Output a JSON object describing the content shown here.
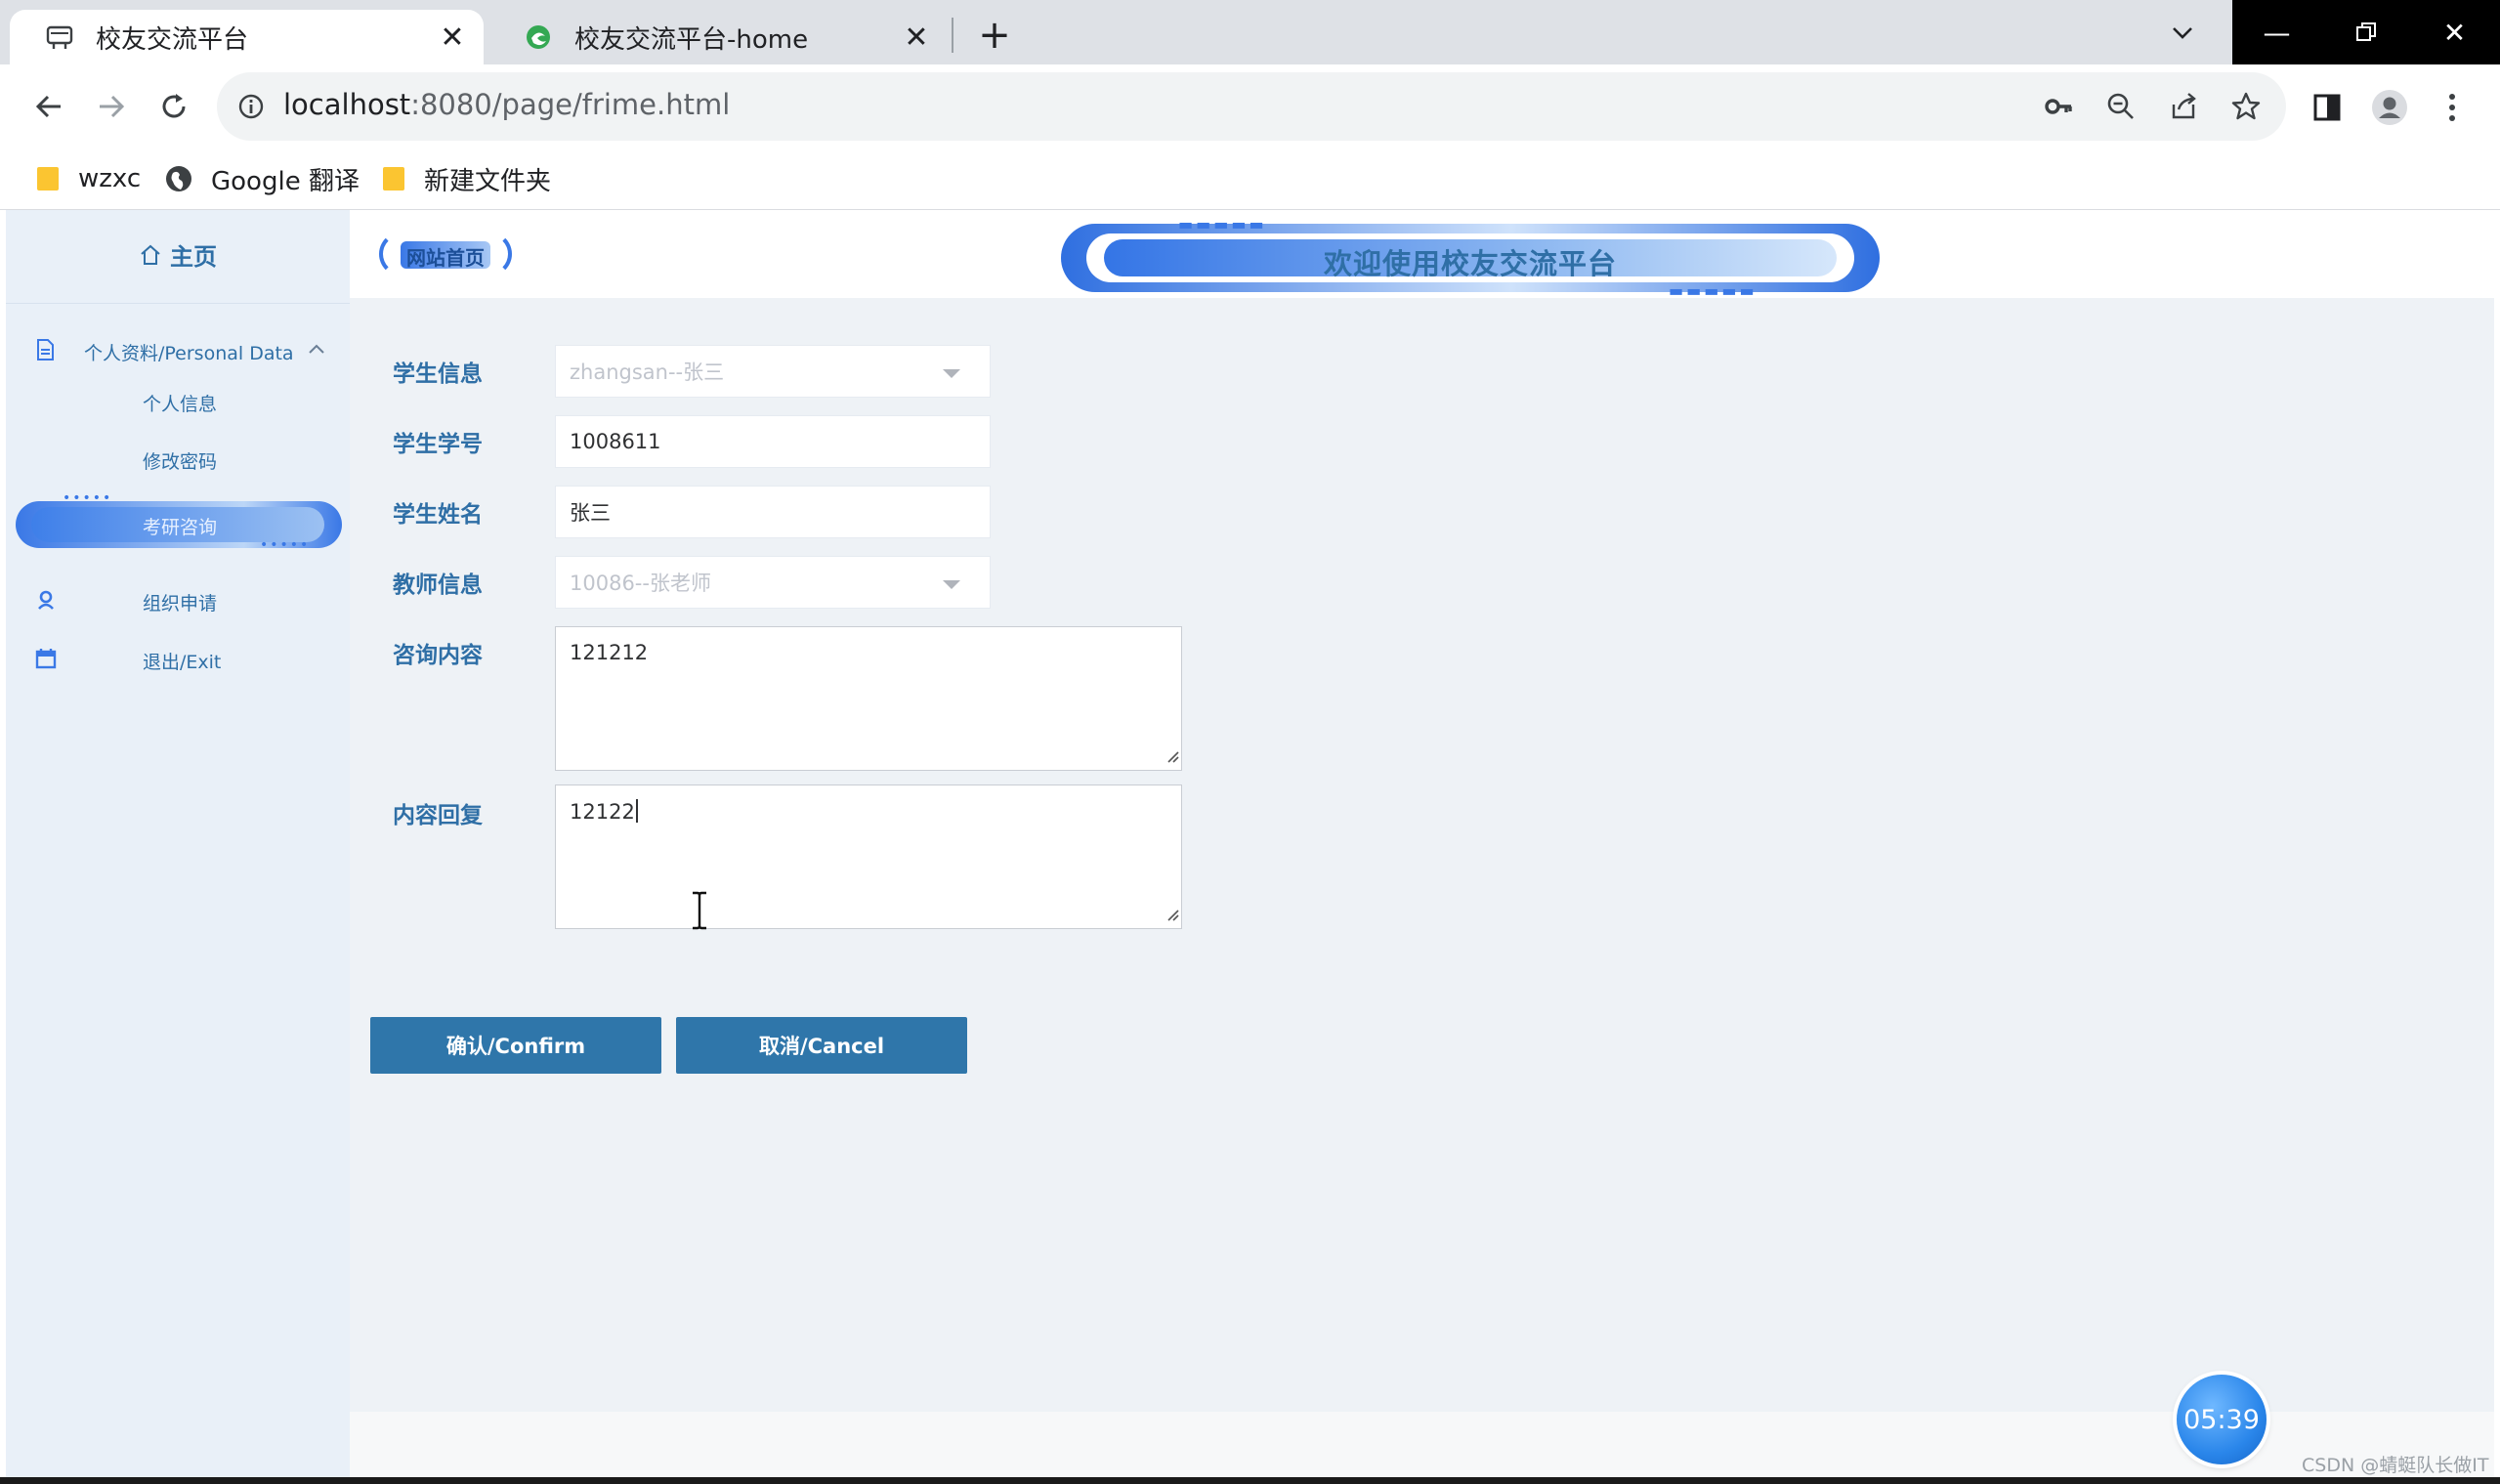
{
  "browser": {
    "tabs": [
      {
        "title": "校友交流平台",
        "active": true
      },
      {
        "title": "校友交流平台-home",
        "active": false
      }
    ],
    "address": {
      "host": "localhost",
      "path": ":8080/page/frime.html"
    },
    "bookmarks": [
      {
        "label": "wzxc",
        "icon": "folder-icon"
      },
      {
        "label": "Google 翻译",
        "icon": "globe-icon"
      },
      {
        "label": "新建文件夹",
        "icon": "folder-icon"
      }
    ]
  },
  "sidebar": {
    "home": "主页",
    "group": {
      "label": "个人资料/Personal Data",
      "expanded": true
    },
    "sub_items": [
      {
        "label": "个人信息"
      },
      {
        "label": "修改密码"
      }
    ],
    "active_item": "考研咨询",
    "items": [
      {
        "label": "组织申请",
        "icon": "user-icon"
      },
      {
        "label": "退出/Exit",
        "icon": "calendar-icon"
      }
    ]
  },
  "header": {
    "site_home": "网站首页",
    "welcome": "欢迎使用校友交流平台"
  },
  "form": {
    "student_info": {
      "label": "学生信息",
      "value": "zhangsan--张三"
    },
    "student_id": {
      "label": "学生学号",
      "value": "1008611"
    },
    "student_name": {
      "label": "学生姓名",
      "value": "张三"
    },
    "teacher_info": {
      "label": "教师信息",
      "value": "10086--张老师"
    },
    "consult_content": {
      "label": "咨询内容",
      "value": "121212"
    },
    "reply_content": {
      "label": "内容回复",
      "value": "12122"
    }
  },
  "buttons": {
    "confirm": "确认/Confirm",
    "cancel": "取消/Cancel"
  },
  "timer": "05:39",
  "watermark": "CSDN @蜻蜓队长做IT",
  "colors": {
    "accent": "#2f76aa",
    "label": "#2f6fa6",
    "sidebar_bg": "#e9f0f8",
    "content_bg": "#eef2f6"
  }
}
